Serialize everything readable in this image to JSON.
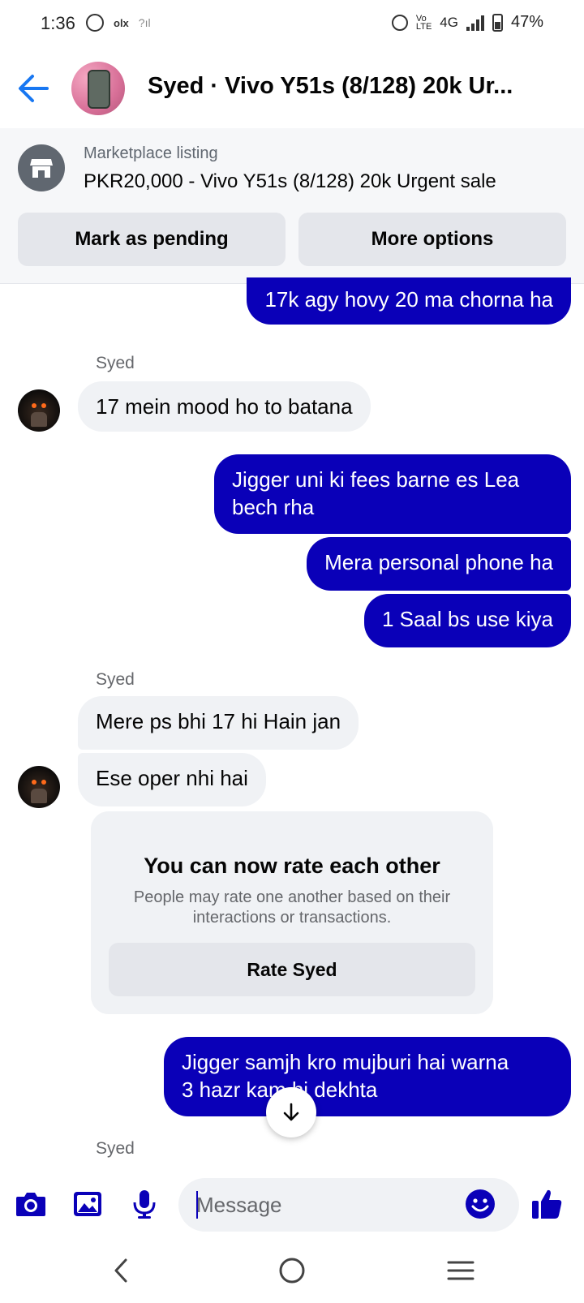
{
  "status_bar": {
    "time": "1:36",
    "network": "4G",
    "battery": "47%"
  },
  "header": {
    "title": "Syed · Vivo Y51s (8/128) 20k Ur..."
  },
  "listing": {
    "label": "Marketplace listing",
    "title": "PKR20,000 - Vivo Y51s (8/128) 20k Urgent sale",
    "mark_pending": "Mark as pending",
    "more_options": "More options"
  },
  "messages": [
    {
      "text": "17k agy hovy 20 ma chorna ha"
    },
    {
      "sender": "Syed",
      "text": "17 mein mood ho to batana"
    },
    {
      "text_line1": "Jigger uni ki fees barne es Lea",
      "text_line2": "bech rha"
    },
    {
      "text": "Mera personal phone ha"
    },
    {
      "text": "1 Saal bs use kiya"
    },
    {
      "sender": "Syed",
      "text": "Mere ps bhi 17 hi Hain jan"
    },
    {
      "text": "Ese oper nhi hai"
    },
    {
      "text_line1": "Jigger samjh kro mujburi hai warna",
      "text_line2": "3 hazr kam hi dekhta"
    },
    {
      "sender": "Syed"
    }
  ],
  "rate_card": {
    "title": "You can now rate each other",
    "subtitle": "People may rate one another based on their interactions or transactions.",
    "button": "Rate Syed"
  },
  "composer": {
    "placeholder": "Message"
  },
  "colors": {
    "sent_bubble": "#0a00b8",
    "received_bubble": "#f0f2f5",
    "accent": "#0a00b8",
    "back_arrow": "#1877f2"
  }
}
